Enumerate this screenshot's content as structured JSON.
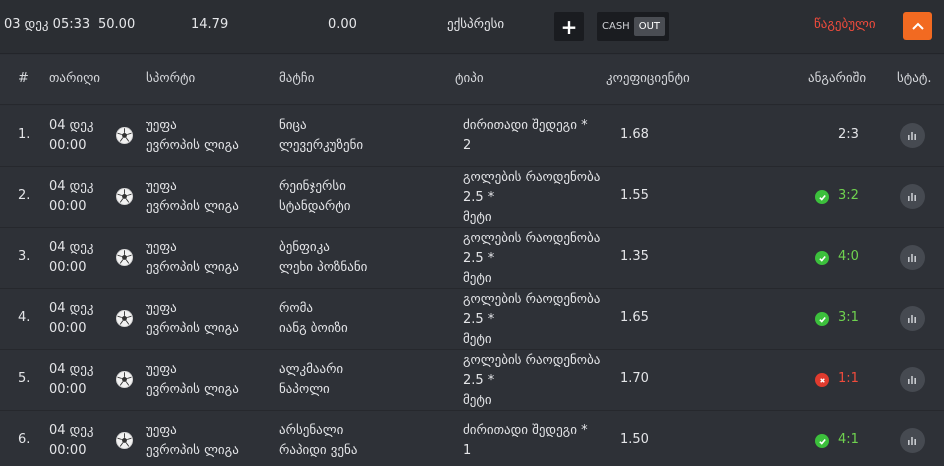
{
  "summary": {
    "datetime": "03 დეკ 05:33",
    "stake": "50.00",
    "odds": "14.79",
    "payout": "0.00",
    "bet_type": "ექსპრესი",
    "cashout_label_cash": "CASH",
    "cashout_label_out": "OUT",
    "status": "წაგებული",
    "colors": {
      "accent": "#f26a21",
      "lost": "#ef4b3c",
      "won": "#6fd24f"
    }
  },
  "columns": {
    "num": "#",
    "date": "თარიღი",
    "sport": "სპორტი",
    "match": "მატჩი",
    "type": "ტიპი",
    "coef": "კოეფიციენტი",
    "result": "ანგარიში",
    "stat": "სტატ."
  },
  "rows": [
    {
      "num": "1.",
      "date": "04 დეკ",
      "time": "00:00",
      "league1": "უეფა",
      "league2": "ევროპის ლიგა",
      "team1": "ნიცა",
      "team2": "ლევერკუზენი",
      "type1": "ძირითადი შედეგი *",
      "type2": "2",
      "type3": "",
      "coef": "1.68",
      "score": "2:3",
      "result": "none",
      "sport_icon": "soccer-ball-icon"
    },
    {
      "num": "2.",
      "date": "04 დეკ",
      "time": "00:00",
      "league1": "უეფა",
      "league2": "ევროპის ლიგა",
      "team1": "რეინჯერსი",
      "team2": "სტანდარტი",
      "type1": "გოლების რაოდენობა",
      "type2": "2.5 *",
      "type3": "მეტი",
      "coef": "1.55",
      "score": "3:2",
      "result": "win",
      "sport_icon": "soccer-ball-icon"
    },
    {
      "num": "3.",
      "date": "04 დეკ",
      "time": "00:00",
      "league1": "უეფა",
      "league2": "ევროპის ლიგა",
      "team1": "ბენფიკა",
      "team2": "ლეხი პოზნანი",
      "type1": "გოლების რაოდენობა",
      "type2": "2.5 *",
      "type3": "მეტი",
      "coef": "1.35",
      "score": "4:0",
      "result": "win",
      "sport_icon": "soccer-ball-icon"
    },
    {
      "num": "4.",
      "date": "04 დეკ",
      "time": "00:00",
      "league1": "უეფა",
      "league2": "ევროპის ლიგა",
      "team1": "რომა",
      "team2": "იანგ ბოიზი",
      "type1": "გოლების რაოდენობა",
      "type2": "2.5 *",
      "type3": "მეტი",
      "coef": "1.65",
      "score": "3:1",
      "result": "win",
      "sport_icon": "soccer-ball-icon"
    },
    {
      "num": "5.",
      "date": "04 დეკ",
      "time": "00:00",
      "league1": "უეფა",
      "league2": "ევროპის ლიგა",
      "team1": "ალკმაარი",
      "team2": "ნაპოლი",
      "type1": "გოლების რაოდენობა",
      "type2": "2.5 *",
      "type3": "მეტი",
      "coef": "1.70",
      "score": "1:1",
      "result": "lose",
      "sport_icon": "soccer-ball-icon"
    },
    {
      "num": "6.",
      "date": "04 დეკ",
      "time": "00:00",
      "league1": "უეფა",
      "league2": "ევროპის ლიგა",
      "team1": "არსენალი",
      "team2": "რაპიდი ვენა",
      "type1": "ძირითადი შედეგი *",
      "type2": "1",
      "type3": "",
      "coef": "1.50",
      "score": "4:1",
      "result": "win",
      "sport_icon": "soccer-ball-icon"
    }
  ]
}
